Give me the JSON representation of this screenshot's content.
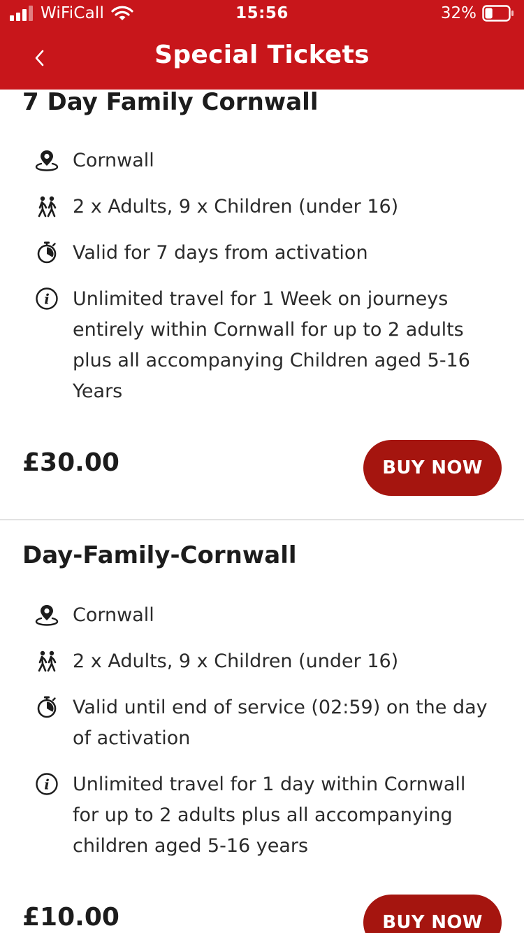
{
  "status_bar": {
    "carrier": "WiFiCall",
    "time": "15:56",
    "battery_percent": "32%",
    "battery_level": 0.32,
    "signal_bars": 3
  },
  "nav": {
    "title": "Special Tickets",
    "back_icon": "chevron-left-icon"
  },
  "colors": {
    "header": "#c8161b",
    "buy_button": "#a5150f",
    "text": "#1c1c1c"
  },
  "tickets": [
    {
      "title": "7 Day Family Cornwall",
      "details": [
        {
          "icon": "location-pin-icon",
          "text": "Cornwall"
        },
        {
          "icon": "people-walking-icon",
          "text": "2 x Adults, 9 x Children (under 16)"
        },
        {
          "icon": "stopwatch-icon",
          "text": "Valid for 7 days from activation"
        },
        {
          "icon": "info-icon",
          "text": "Unlimited travel for 1 Week on journeys entirely within Cornwall for up to 2 adults plus all accompanying Children aged 5-16 Years"
        }
      ],
      "price": "£30.00",
      "button_label": "BUY NOW"
    },
    {
      "title": "Day-Family-Cornwall",
      "details": [
        {
          "icon": "location-pin-icon",
          "text": "Cornwall"
        },
        {
          "icon": "people-walking-icon",
          "text": "2 x Adults, 9 x Children (under 16)"
        },
        {
          "icon": "stopwatch-icon",
          "text": "Valid until end of service (02:59) on the day of activation"
        },
        {
          "icon": "info-icon",
          "text": "Unlimited travel for 1 day within Cornwall for up to 2 adults plus all accompanying children aged 5-16 years"
        }
      ],
      "price": "£10.00",
      "button_label": "BUY NOW"
    }
  ]
}
